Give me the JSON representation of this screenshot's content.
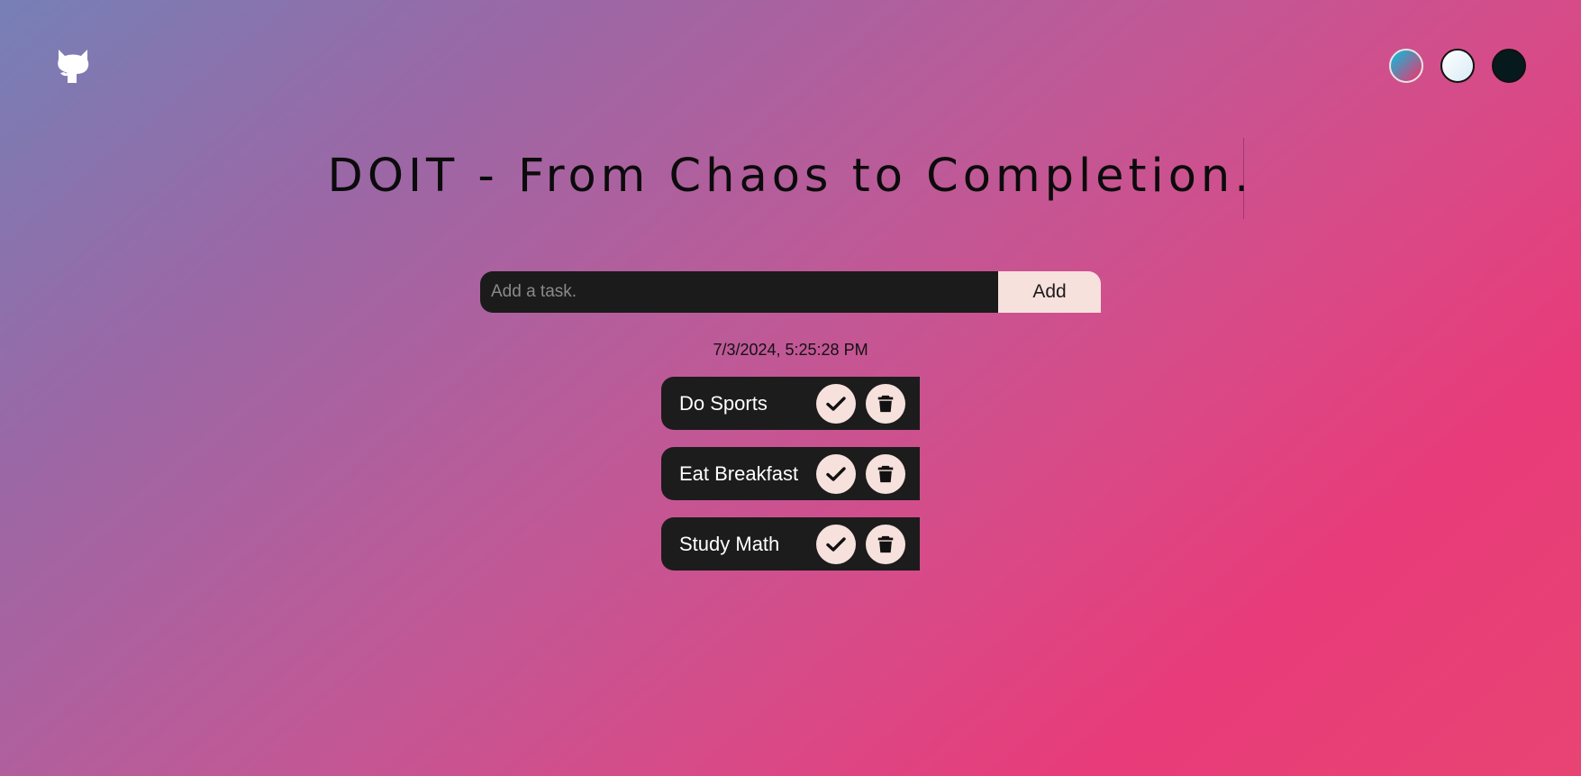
{
  "header": {
    "github_icon": "github-icon",
    "themes": [
      {
        "name": "gradient-theme",
        "color": "#17b4d4"
      },
      {
        "name": "light-theme",
        "color": "#ffffff"
      },
      {
        "name": "dark-theme",
        "color": "#061a1d"
      }
    ]
  },
  "title": "DOIT - From Chaos to Completion.",
  "form": {
    "placeholder": "Add a task.",
    "value": "",
    "add_label": "Add"
  },
  "datetime": "7/3/2024, 5:25:28 PM",
  "tasks": [
    {
      "label": "Do Sports",
      "check_icon": "check-icon",
      "delete_icon": "trash-icon"
    },
    {
      "label": "Eat Breakfast",
      "check_icon": "check-icon",
      "delete_icon": "trash-icon"
    },
    {
      "label": "Study Math",
      "check_icon": "check-icon",
      "delete_icon": "trash-icon"
    }
  ],
  "colors": {
    "accent": "#f7e1dc",
    "task_bg": "#1c1c1c",
    "gradient_start": "#7680b6",
    "gradient_end": "#e83b7a"
  }
}
